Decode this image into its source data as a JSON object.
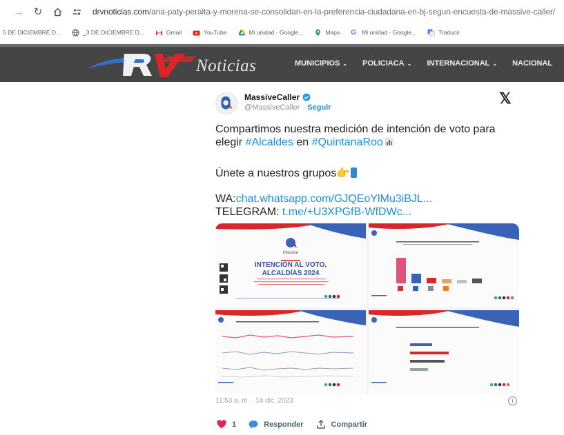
{
  "browser": {
    "url_host": "drvnoticias.com",
    "url_path": "/ana-paty-peralta-y-morena-se-consolidan-en-la-preferencia-ciudadana-en-bj-segun-encuesta-de-massive-caller/",
    "bookmarks": [
      {
        "label": "5 DE DICIEMBRE D...",
        "icon": "generic-page-icon"
      },
      {
        "label": "_3 DE DICIEMBRE D...",
        "icon": "globe-icon"
      },
      {
        "label": "Gmail",
        "icon": "gmail-icon"
      },
      {
        "label": "YouTube",
        "icon": "youtube-icon"
      },
      {
        "label": "Mi unidad - Google...",
        "icon": "drive-icon"
      },
      {
        "label": "Maps",
        "icon": "maps-icon"
      },
      {
        "label": "Mi unidad - Google...",
        "icon": "google-icon"
      },
      {
        "label": "Traducir",
        "icon": "translate-icon"
      }
    ]
  },
  "site": {
    "logo_word": "Noticias",
    "menu": [
      {
        "label": "MUNICIPIOS"
      },
      {
        "label": "POLICIACA"
      },
      {
        "label": "INTERNACIONAL"
      },
      {
        "label": "NACIONAL"
      }
    ],
    "colors": {
      "header_bg": "#454545",
      "accent_red": "#d9262b",
      "accent_blue": "#3a63b8"
    }
  },
  "tweet": {
    "author_name": "MassiveCaller",
    "handle": "@MassiveCaller",
    "follow_label": "Seguir",
    "text_part1": "Compartimos nuestra medición de intención de voto para elegir ",
    "hashtag1": "#Alcaldes",
    "text_part2": " en ",
    "hashtag2": "#QuintanaRoo",
    "text_line2": "Únete a nuestros grupos👉",
    "wa_label": "WA:",
    "wa_link": "chat.whatsapp.com/GJQEoYlMu3iBJL...",
    "telegram_label": "TELEGRAM: ",
    "telegram_link": "t.me/+U3XPGfB-WfDWc...",
    "media_title_line1": "INTENCIÓN AL VOTO,",
    "media_title_line2": "ALCALDÍAS 2024",
    "media_brand": "Massive",
    "timestamp": "11:53 a. m. · 14 dic. 2023",
    "like_count": "1",
    "reply_label": "Responder",
    "share_label": "Compartir",
    "colors": {
      "link": "#1d8fd8",
      "like": "#e0245e",
      "verified": "#1d9bf0"
    }
  }
}
